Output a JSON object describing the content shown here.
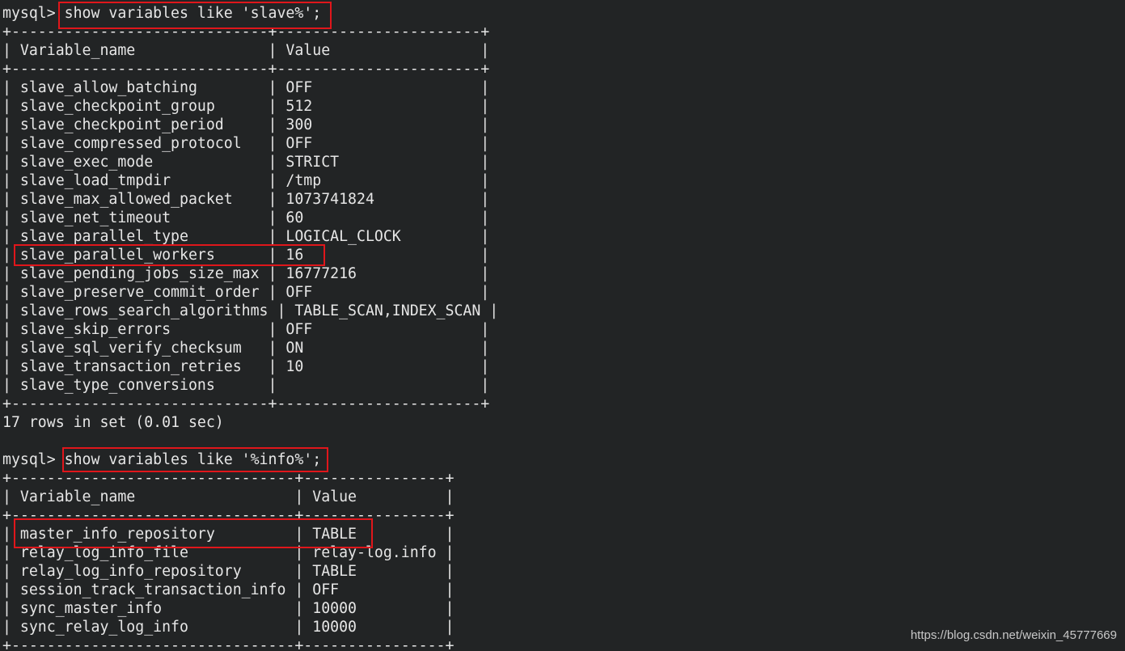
{
  "highlight_color": "#e0161b",
  "background_color": "#222425",
  "text_color": "#e6e6e6",
  "lines": [
    "mysql> show variables like 'slave%';",
    "+-----------------------------+-----------------------+",
    "| Variable_name               | Value                 |",
    "+-----------------------------+-----------------------+",
    "| slave_allow_batching        | OFF                   |",
    "| slave_checkpoint_group      | 512                   |",
    "| slave_checkpoint_period     | 300                   |",
    "| slave_compressed_protocol   | OFF                   |",
    "| slave_exec_mode             | STRICT                |",
    "| slave_load_tmpdir           | /tmp                  |",
    "| slave_max_allowed_packet    | 1073741824            |",
    "| slave_net_timeout           | 60                    |",
    "| slave_parallel_type         | LOGICAL_CLOCK         |",
    "| slave_parallel_workers      | 16                    |",
    "| slave_pending_jobs_size_max | 16777216              |",
    "| slave_preserve_commit_order | OFF                   |",
    "| slave_rows_search_algorithms | TABLE_SCAN,INDEX_SCAN |",
    "| slave_skip_errors           | OFF                   |",
    "| slave_sql_verify_checksum   | ON                    |",
    "| slave_transaction_retries   | 10                    |",
    "| slave_type_conversions      |                       |",
    "+-----------------------------+-----------------------+",
    "17 rows in set (0.01 sec)",
    "",
    "mysql> show variables like '%info%';",
    "+--------------------------------+----------------+",
    "| Variable_name                  | Value          |",
    "+--------------------------------+----------------+",
    "| master_info_repository         | TABLE          |",
    "| relay_log_info_file            | relay-log.info |",
    "| relay_log_info_repository      | TABLE          |",
    "| session_track_transaction_info | OFF            |",
    "| sync_master_info               | 10000          |",
    "| sync_relay_log_info            | 10000          |",
    "+--------------------------------+----------------+"
  ],
  "watermark": "https://blog.csdn.net/weixin_45777669"
}
